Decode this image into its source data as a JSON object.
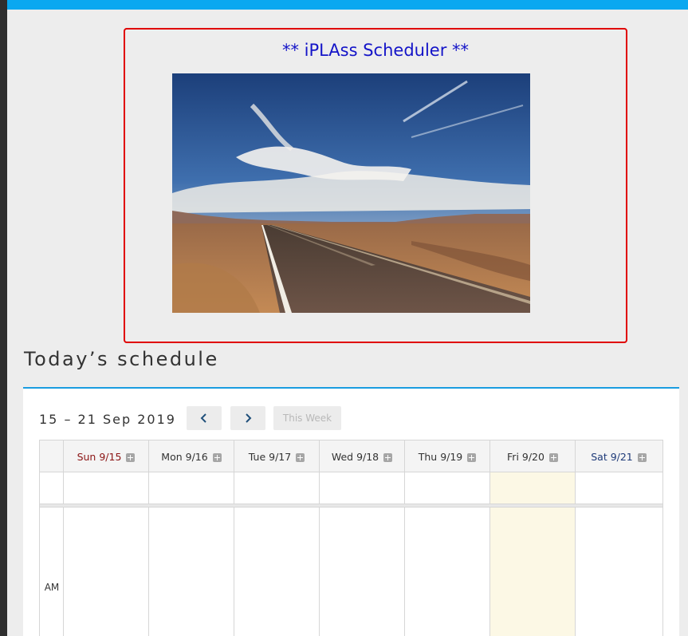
{
  "banner": {
    "title": "** iPLAss Scheduler **",
    "image_alt": "desert road under blue sky"
  },
  "section": {
    "title": "Today’s schedule"
  },
  "calendar": {
    "range_label": "15 – 21 Sep 2019",
    "prev_icon": "chevron-left-icon",
    "next_icon": "chevron-right-icon",
    "this_week_label": "This Week",
    "days": [
      {
        "label": "Sun 9/15",
        "kind": "sun"
      },
      {
        "label": "Mon 9/16",
        "kind": "weekday"
      },
      {
        "label": "Tue 9/17",
        "kind": "weekday"
      },
      {
        "label": "Wed 9/18",
        "kind": "weekday"
      },
      {
        "label": "Thu 9/19",
        "kind": "weekday"
      },
      {
        "label": "Fri 9/20",
        "kind": "today"
      },
      {
        "label": "Sat 9/21",
        "kind": "sat"
      }
    ],
    "am_label": "AM"
  },
  "colors": {
    "top_bar": "#0aa8f0",
    "banner_border": "#e00000",
    "banner_title": "#1414c8",
    "panel_rule": "#1a9ce0",
    "today_bg": "#fcf8e5",
    "sunday_text": "#8b1414",
    "saturday_text": "#1e3a78"
  }
}
